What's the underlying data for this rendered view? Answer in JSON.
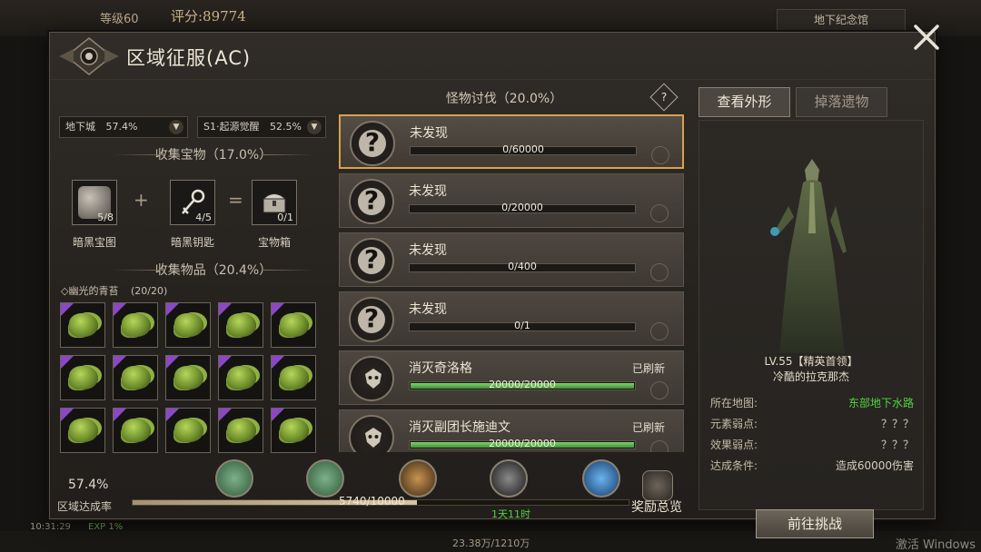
{
  "background": {
    "level": "等级60",
    "score": "评分:89774",
    "area": "地下纪念馆",
    "capacity": "23.38万/1210万",
    "time": "10:31:29",
    "exp": "EXP 1%",
    "activate_windows": "激活 Windows"
  },
  "header": {
    "title": "区域征服(AC)"
  },
  "left": {
    "dungeon_select": {
      "label": "地下城",
      "value": "57.4%"
    },
    "season_select": {
      "label": "S1·起源觉醒",
      "value": "52.5%"
    },
    "treasure_head": "收集宝物（17.0%）",
    "treasures": [
      {
        "name": "暗黑宝图",
        "count": "5/8"
      },
      {
        "name": "暗黑钥匙",
        "count": "4/5"
      },
      {
        "name": "宝物箱",
        "count": "0/1"
      }
    ],
    "plus": "+",
    "equals": "=",
    "items_head": "收集物品（20.4%）",
    "group_name": "◇幽光的青苔",
    "group_count": "(20/20)"
  },
  "middle": {
    "head": "怪物讨伐（20.0%）",
    "help": "?",
    "monsters": [
      {
        "name": "未发现",
        "progress": "0/60000",
        "fraction": 0,
        "refresh": "",
        "kind": "unknown",
        "active": true
      },
      {
        "name": "未发现",
        "progress": "0/20000",
        "fraction": 0,
        "refresh": "",
        "kind": "unknown",
        "active": false
      },
      {
        "name": "未发现",
        "progress": "0/400",
        "fraction": 0,
        "refresh": "",
        "kind": "unknown",
        "active": false
      },
      {
        "name": "未发现",
        "progress": "0/1",
        "fraction": 0,
        "refresh": "",
        "kind": "unknown",
        "active": false
      },
      {
        "name": "消灭奇洛格",
        "progress": "20000/20000",
        "fraction": 1,
        "refresh": "已刷新",
        "kind": "boss",
        "active": false
      },
      {
        "name": "消灭副团长施迪文",
        "progress": "20000/20000",
        "fraction": 1,
        "refresh": "已刷新",
        "kind": "boss",
        "active": false
      }
    ]
  },
  "right": {
    "tab_appearance": "查看外形",
    "tab_drops": "掉落遗物",
    "boss_level": "LV.55【精英首领】",
    "boss_name": "冷酷的拉克那杰",
    "info": [
      {
        "label": "所在地图:",
        "value": "东部地下水路",
        "green": true
      },
      {
        "label": "元素弱点:",
        "value": "？？？",
        "green": false
      },
      {
        "label": "效果弱点:",
        "value": "？？？",
        "green": false
      },
      {
        "label": "达成条件:",
        "value": "造成60000伤害",
        "green": false
      }
    ],
    "challenge_button": "前往挑战"
  },
  "footer": {
    "rate_value": "57.4%",
    "rate_label": "区域达成率",
    "progress_text": "5740/10000",
    "progress_fraction": 0.574,
    "timer": "1天11时",
    "reward_label": "奖励总览"
  }
}
